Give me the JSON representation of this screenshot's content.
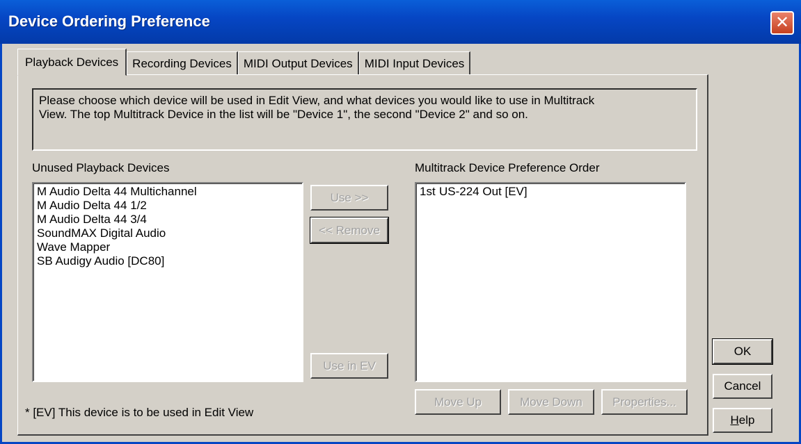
{
  "window": {
    "title": "Device Ordering Preference",
    "close_glyph": "✕"
  },
  "tabs": [
    {
      "label": "Playback Devices",
      "active": true
    },
    {
      "label": "Recording Devices",
      "active": false
    },
    {
      "label": "MIDI Output Devices",
      "active": false
    },
    {
      "label": "MIDI Input Devices",
      "active": false
    }
  ],
  "description": "Please choose which device will be used in Edit View, and what devices you would like to use in Multitrack\nView.  The top Multitrack Device in the list will be \"Device 1\", the second \"Device 2\" and so on.",
  "unused": {
    "label": "Unused Playback Devices",
    "items": [
      "M Audio Delta 44 Multichannel",
      "M Audio Delta 44 1/2",
      "M Audio Delta 44 3/4",
      "SoundMAX Digital Audio",
      "Wave Mapper",
      "SB Audigy Audio [DC80]"
    ]
  },
  "order": {
    "label": "Multitrack Device Preference Order",
    "items": [
      {
        "num": "1st",
        "name": "US-224 Out [EV]"
      }
    ]
  },
  "buttons": {
    "use": "Use >>",
    "remove": "<< Remove",
    "use_in_ev": "Use in EV",
    "move_up": "Move Up",
    "move_down": "Move Down",
    "properties": "Properties..."
  },
  "footnote": "* [EV] This device is to be used in Edit View",
  "dialog_buttons": {
    "ok": "OK",
    "cancel": "Cancel",
    "help": "Help"
  }
}
